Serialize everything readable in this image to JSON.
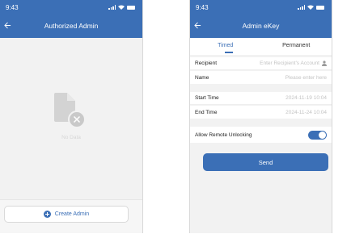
{
  "left_screen": {
    "status_time": "9:43",
    "title": "Authorized Admin",
    "empty_text": "No Data",
    "create_button_label": "Create Admin"
  },
  "right_screen": {
    "status_time": "9:43",
    "title": "Admin eKey",
    "tabs": [
      {
        "label": "Timed",
        "active": true
      },
      {
        "label": "Permanent",
        "active": false
      }
    ],
    "form": {
      "recipient_label": "Recipient",
      "recipient_placeholder": "Enter Recipient's Account",
      "name_label": "Name",
      "name_placeholder": "Please enter here",
      "start_time_label": "Start Time",
      "start_time_value": "2024-11-19 10:04",
      "end_time_label": "End Time",
      "end_time_value": "2024-11-24 10:04",
      "remote_unlock_label": "Allow Remote Unlocking",
      "remote_unlock_enabled": true
    },
    "send_button_label": "Send"
  },
  "colors": {
    "primary": "#3b6fb6",
    "background": "#f2f2f2",
    "placeholder": "#c3c3c3"
  },
  "icons": [
    "back-arrow-icon",
    "signal-icon",
    "wifi-icon",
    "battery-icon",
    "no-data-document-icon",
    "plus-circle-icon",
    "person-icon"
  ]
}
